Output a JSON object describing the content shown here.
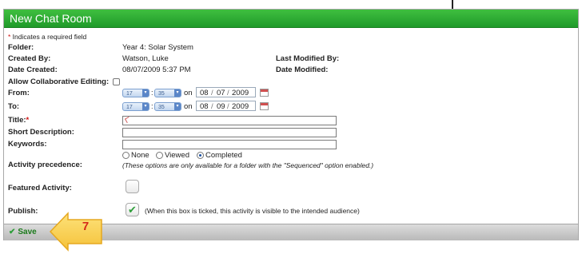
{
  "window": {
    "title": "New Chat Room"
  },
  "notice": {
    "asterisk": "*",
    "text": " Indicates a required field"
  },
  "folder": {
    "label": "Folder:",
    "value": "Year 4: Solar System"
  },
  "created_by": {
    "label": "Created By:",
    "value": "Watson, Luke"
  },
  "last_modified_by": {
    "label": "Last Modified By:"
  },
  "date_created": {
    "label": "Date Created:",
    "value": "08/07/2009 5:37 PM"
  },
  "date_modified": {
    "label": "Date Modified:"
  },
  "collab": {
    "label": "Allow Collaborative Editing:"
  },
  "from": {
    "label": "From:",
    "hour": "17",
    "minute": "35",
    "on": "on",
    "day": "08",
    "month": "07",
    "year": "2009",
    "sep": "/"
  },
  "to": {
    "label": "To:",
    "hour": "17",
    "minute": "35",
    "on": "on",
    "day": "08",
    "month": "09",
    "year": "2009",
    "sep": "/"
  },
  "title_field": {
    "label": "Title:",
    "asterisk": "*",
    "value": ""
  },
  "short_description": {
    "label": "Short Description:",
    "value": ""
  },
  "keywords": {
    "label": "Keywords:",
    "value": ""
  },
  "activity_precedence": {
    "label": "Activity precedence:",
    "options": [
      "None",
      "Viewed",
      "Completed"
    ],
    "selected": "Completed",
    "note": "(These options are only available for a folder with the \"Sequenced\" option enabled.)"
  },
  "featured_activity": {
    "label": "Featured Activity:",
    "checked": false
  },
  "publish": {
    "label": "Publish:",
    "checked": true,
    "note": "(When this box is ticked, this activity is visible to the intended audience)"
  },
  "footer": {
    "save_label": "Save"
  },
  "callout": {
    "number": "7",
    "color": "#f7c948"
  },
  "colors": {
    "header_green": "#2aa834",
    "required_red": "#d01010",
    "save_green": "#1b7a1b"
  }
}
